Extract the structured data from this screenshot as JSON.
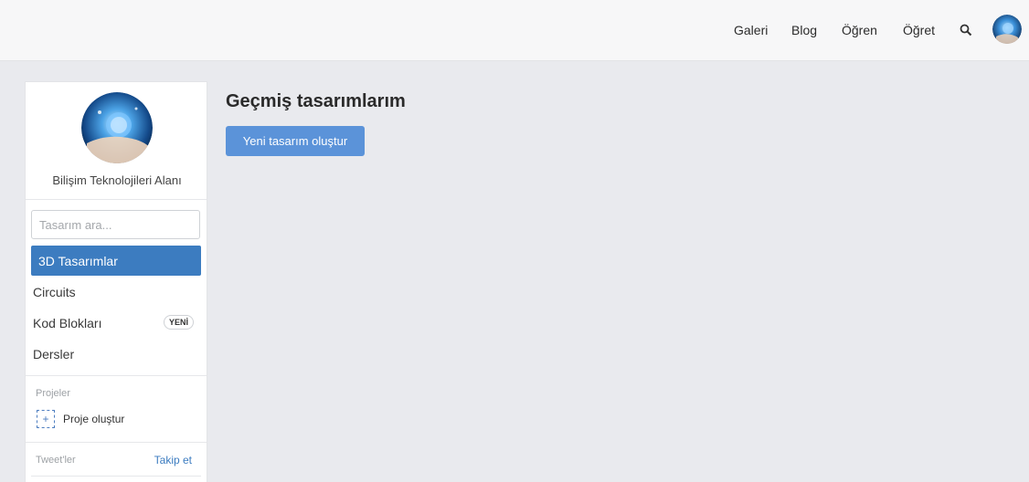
{
  "header": {
    "nav": [
      {
        "label": "Galeri"
      },
      {
        "label": "Blog"
      },
      {
        "label": "Öğren"
      },
      {
        "label": "Öğret"
      }
    ],
    "search_icon": "search-icon",
    "avatar_icon": "user-avatar"
  },
  "sidebar": {
    "profile_name": "Bilişim Teknolojileri Alanı",
    "search": {
      "placeholder": "Tasarım ara...",
      "value": ""
    },
    "items": [
      {
        "label": "3D Tasarımlar",
        "active": true
      },
      {
        "label": "Circuits"
      },
      {
        "label": "Kod Blokları",
        "badge": "YENİ"
      },
      {
        "label": "Dersler"
      }
    ],
    "projects_label": "Projeler",
    "create_project_label": "Proje oluştur",
    "tweets_label": "Tweet'ler",
    "follow_label": "Takip et"
  },
  "main": {
    "title": "Geçmiş tasarımlarım",
    "create_button_label": "Yeni tasarım oluştur"
  },
  "colors": {
    "accent": "#3c7cc0",
    "button": "#5b93d9",
    "background": "#e9eaee"
  }
}
